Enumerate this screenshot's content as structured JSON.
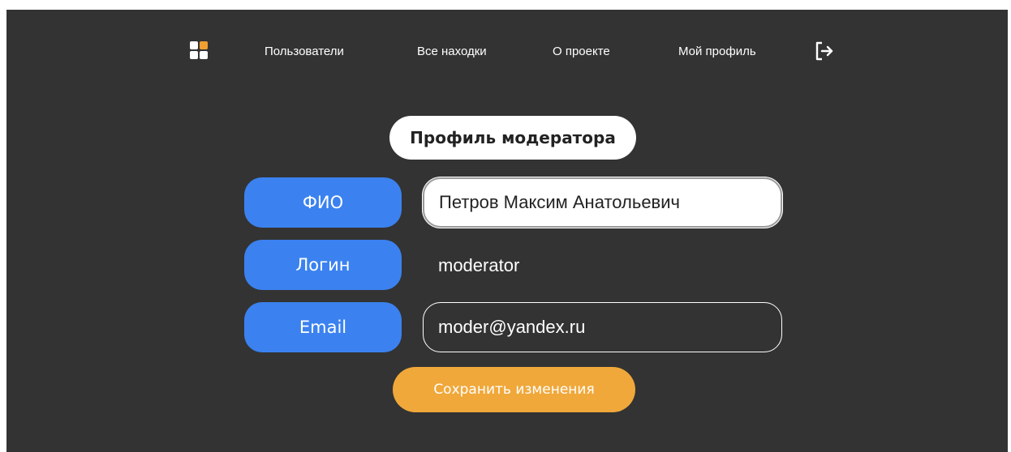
{
  "nav": {
    "logo_icon": "apps-grid-icon",
    "links": [
      "Пользователи",
      "Все находки",
      "О проекте",
      "Мой профиль"
    ],
    "logout_icon": "logout-icon"
  },
  "profile": {
    "title": "Профиль модератора",
    "fio_label": "ФИО",
    "fio_value": "Петров Максим Анатольевич",
    "login_label": "Логин",
    "login_value": "moderator",
    "email_label": "Email",
    "email_value": "moder@yandex.ru",
    "save_label": "Сохранить изменения"
  },
  "colors": {
    "background": "#333333",
    "accent_blue": "#3b82f0",
    "accent_orange": "#f0a83a",
    "logo_accent": "#f0a030"
  }
}
